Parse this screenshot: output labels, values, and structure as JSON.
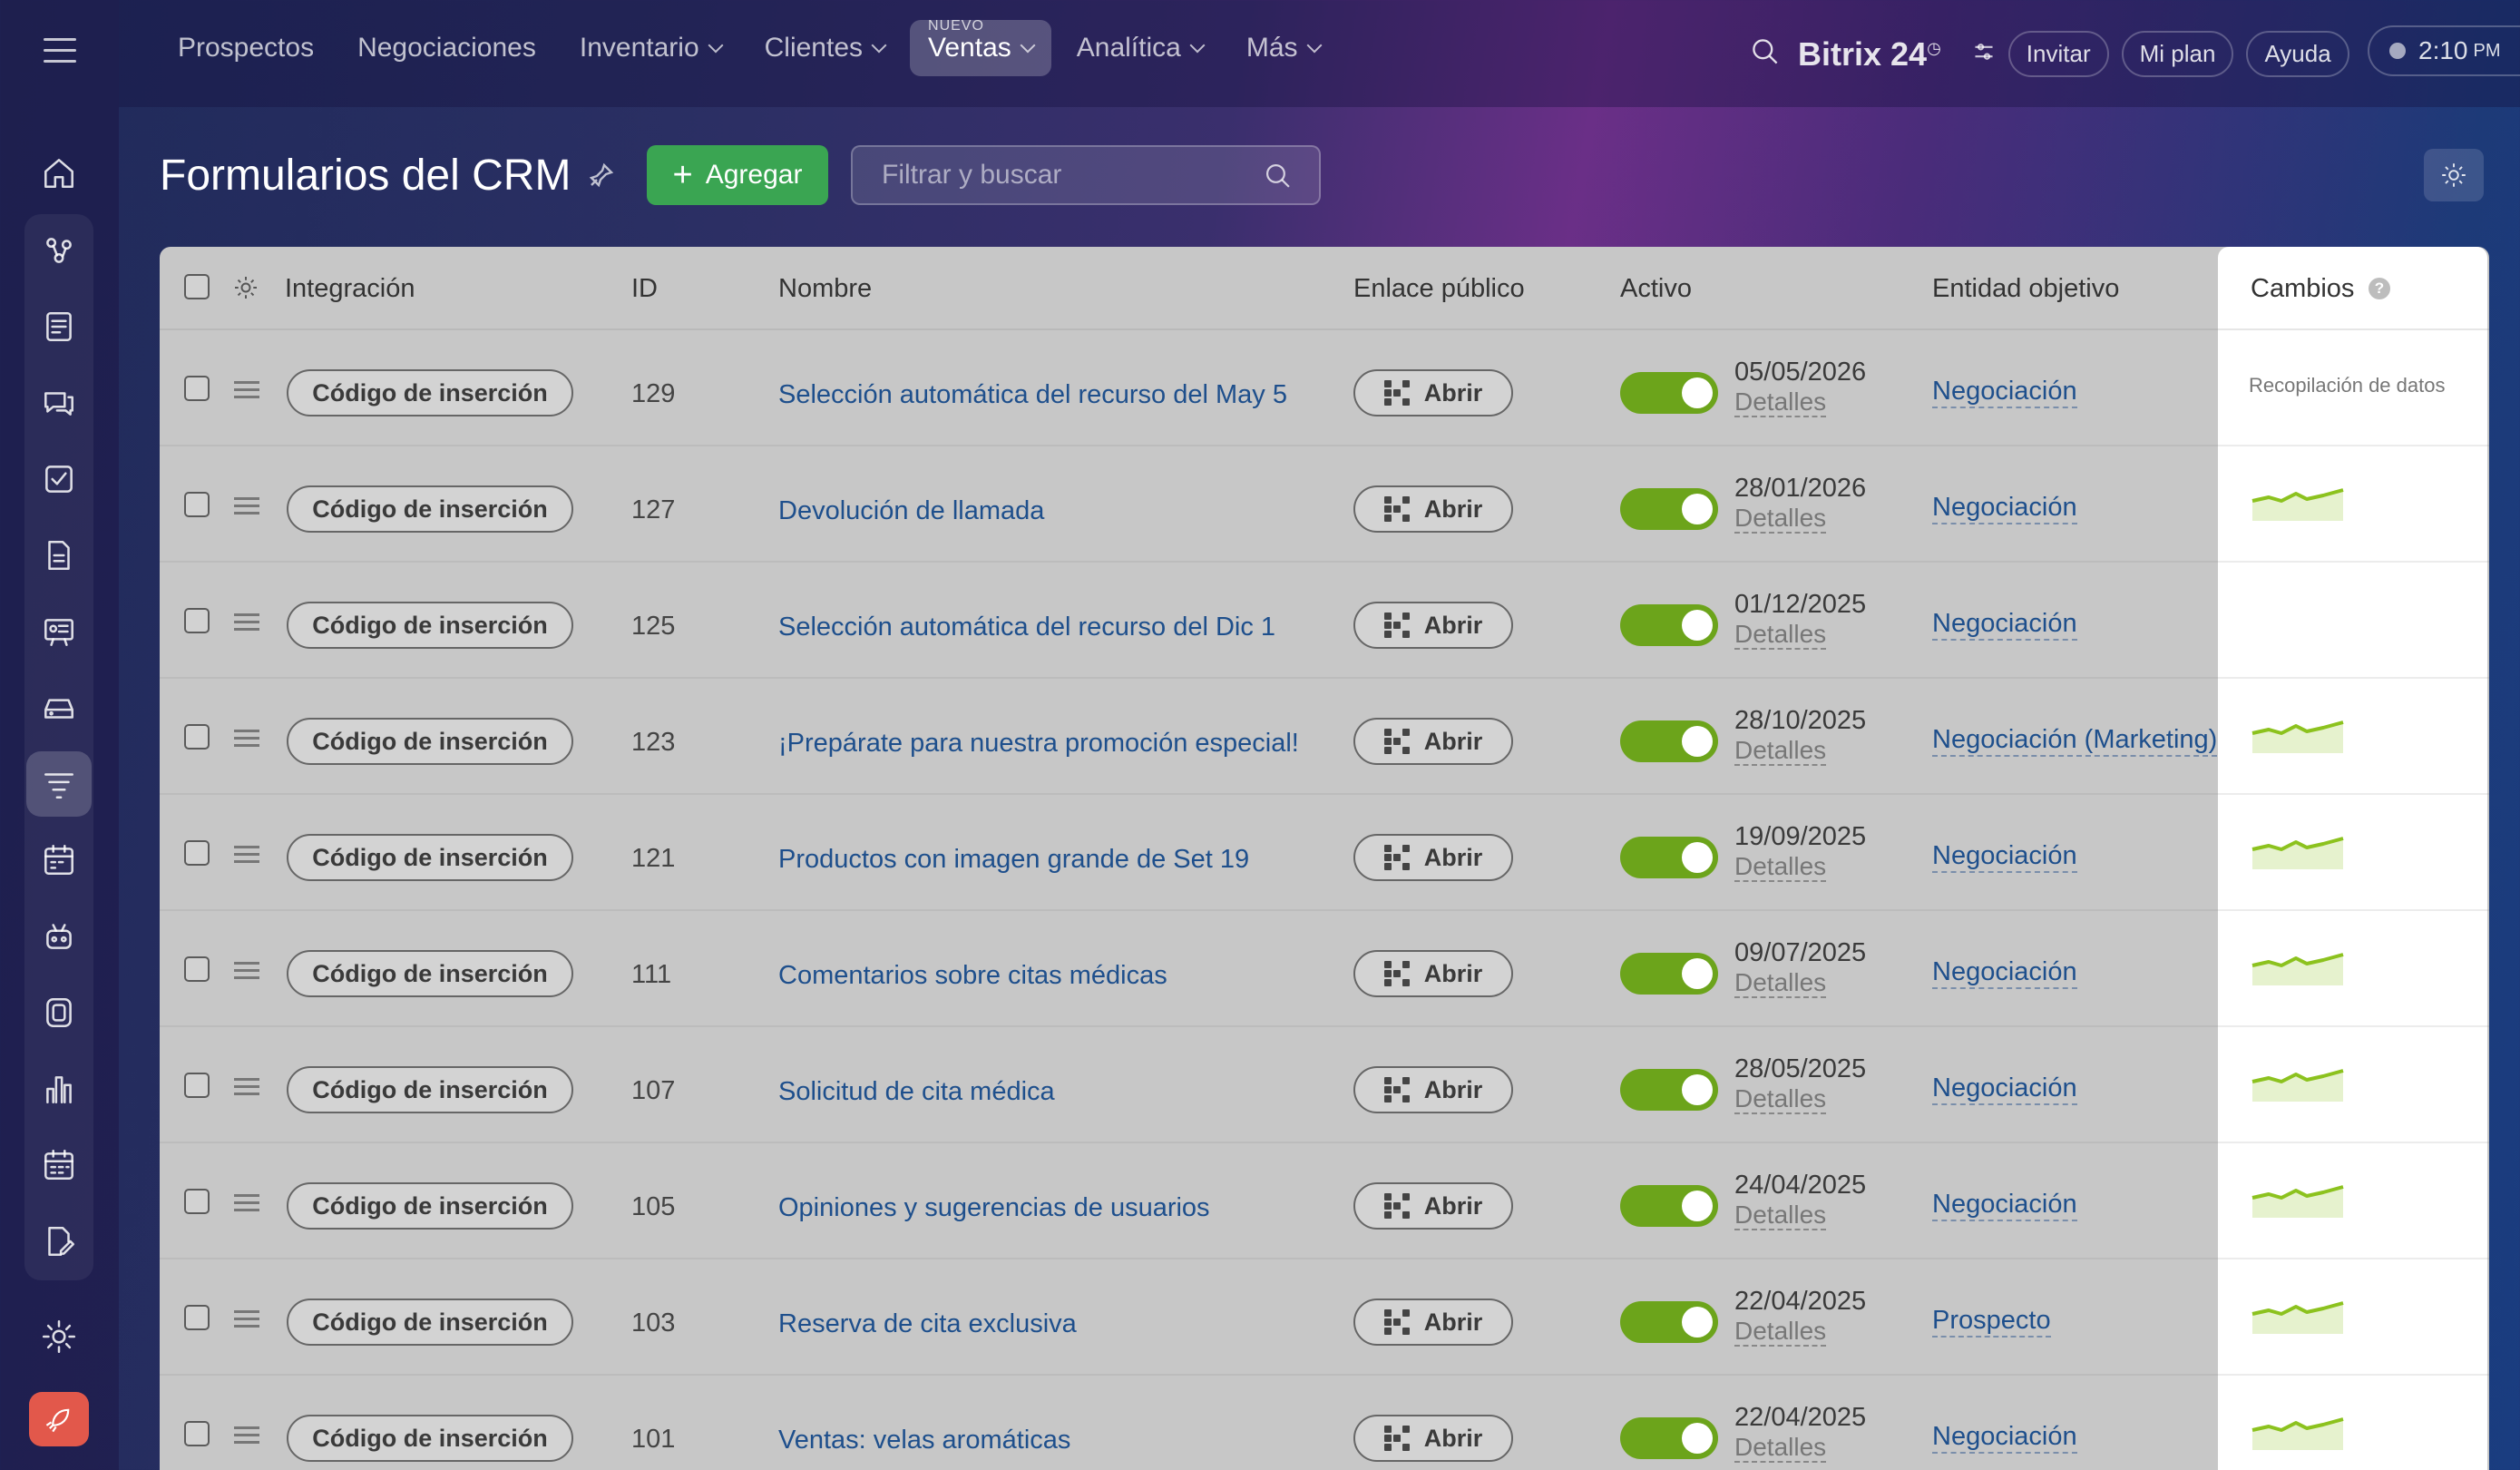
{
  "nav": {
    "items": [
      {
        "label": "Prospectos",
        "chevron": false,
        "active": false
      },
      {
        "label": "Negociaciones",
        "chevron": false,
        "active": false
      },
      {
        "label": "Inventario",
        "chevron": true,
        "active": false
      },
      {
        "label": "Clientes",
        "chevron": true,
        "active": false
      },
      {
        "label": "Ventas",
        "chevron": true,
        "active": true,
        "badge": "NUEVO"
      },
      {
        "label": "Analítica",
        "chevron": true,
        "active": false
      },
      {
        "label": "Más",
        "chevron": true,
        "active": false
      }
    ]
  },
  "header": {
    "brand": "Bitrix 24",
    "invite": "Invitar",
    "plan": "Mi plan",
    "help": "Ayuda",
    "time": "2:10",
    "ampm": "PM"
  },
  "toolbar": {
    "title": "Formularios del CRM",
    "add_label": "Agregar",
    "filter_placeholder": "Filtrar y buscar"
  },
  "table": {
    "columns": {
      "integration": "Integración",
      "id": "ID",
      "name": "Nombre",
      "public_link": "Enlace público",
      "active": "Activo",
      "target": "Entidad objetivo",
      "changes": "Cambios"
    },
    "changes_first_label": "Recopilación de datos",
    "rows": [
      {
        "integration": "Código de inserción",
        "id": "129",
        "name": "Selección automática del recurso del May 5",
        "open": "Abrir",
        "date": "05/05/2026",
        "details": "Detalles",
        "target": "Negociación",
        "spark": false
      },
      {
        "integration": "Código de inserción",
        "id": "127",
        "name": "Devolución de llamada",
        "open": "Abrir",
        "date": "28/01/2026",
        "details": "Detalles",
        "target": "Negociación",
        "spark": true
      },
      {
        "integration": "Código de inserción",
        "id": "125",
        "name": "Selección automática del recurso del Dic 1",
        "open": "Abrir",
        "date": "01/12/2025",
        "details": "Detalles",
        "target": "Negociación",
        "spark": false
      },
      {
        "integration": "Código de inserción",
        "id": "123",
        "name": "¡Prepárate para nuestra promoción especial!",
        "open": "Abrir",
        "date": "28/10/2025",
        "details": "Detalles",
        "target": "Negociación (Marketing)",
        "spark": true
      },
      {
        "integration": "Código de inserción",
        "id": "121",
        "name": "Productos con imagen grande de Set 19",
        "open": "Abrir",
        "date": "19/09/2025",
        "details": "Detalles",
        "target": "Negociación",
        "spark": true
      },
      {
        "integration": "Código de inserción",
        "id": "111",
        "name": "Comentarios sobre citas médicas",
        "open": "Abrir",
        "date": "09/07/2025",
        "details": "Detalles",
        "target": "Negociación",
        "spark": true
      },
      {
        "integration": "Código de inserción",
        "id": "107",
        "name": "Solicitud de cita médica",
        "open": "Abrir",
        "date": "28/05/2025",
        "details": "Detalles",
        "target": "Negociación",
        "spark": true
      },
      {
        "integration": "Código de inserción",
        "id": "105",
        "name": "Opiniones y sugerencias de usuarios",
        "open": "Abrir",
        "date": "24/04/2025",
        "details": "Detalles",
        "target": "Negociación",
        "spark": true
      },
      {
        "integration": "Código de inserción",
        "id": "103",
        "name": "Reserva de cita exclusiva",
        "open": "Abrir",
        "date": "22/04/2025",
        "details": "Detalles",
        "target": "Prospecto",
        "spark": true
      },
      {
        "integration": "Código de inserción",
        "id": "101",
        "name": "Ventas: velas aromáticas",
        "open": "Abrir",
        "date": "22/04/2025",
        "details": "Detalles",
        "target": "Negociación",
        "spark": true
      }
    ]
  },
  "colors": {
    "accent_green": "#3aa552",
    "toggle_green": "#6ca41b",
    "link_blue": "#1e4f8c",
    "spark_green": "#8cc21e",
    "rocket_red": "#e2584b"
  }
}
